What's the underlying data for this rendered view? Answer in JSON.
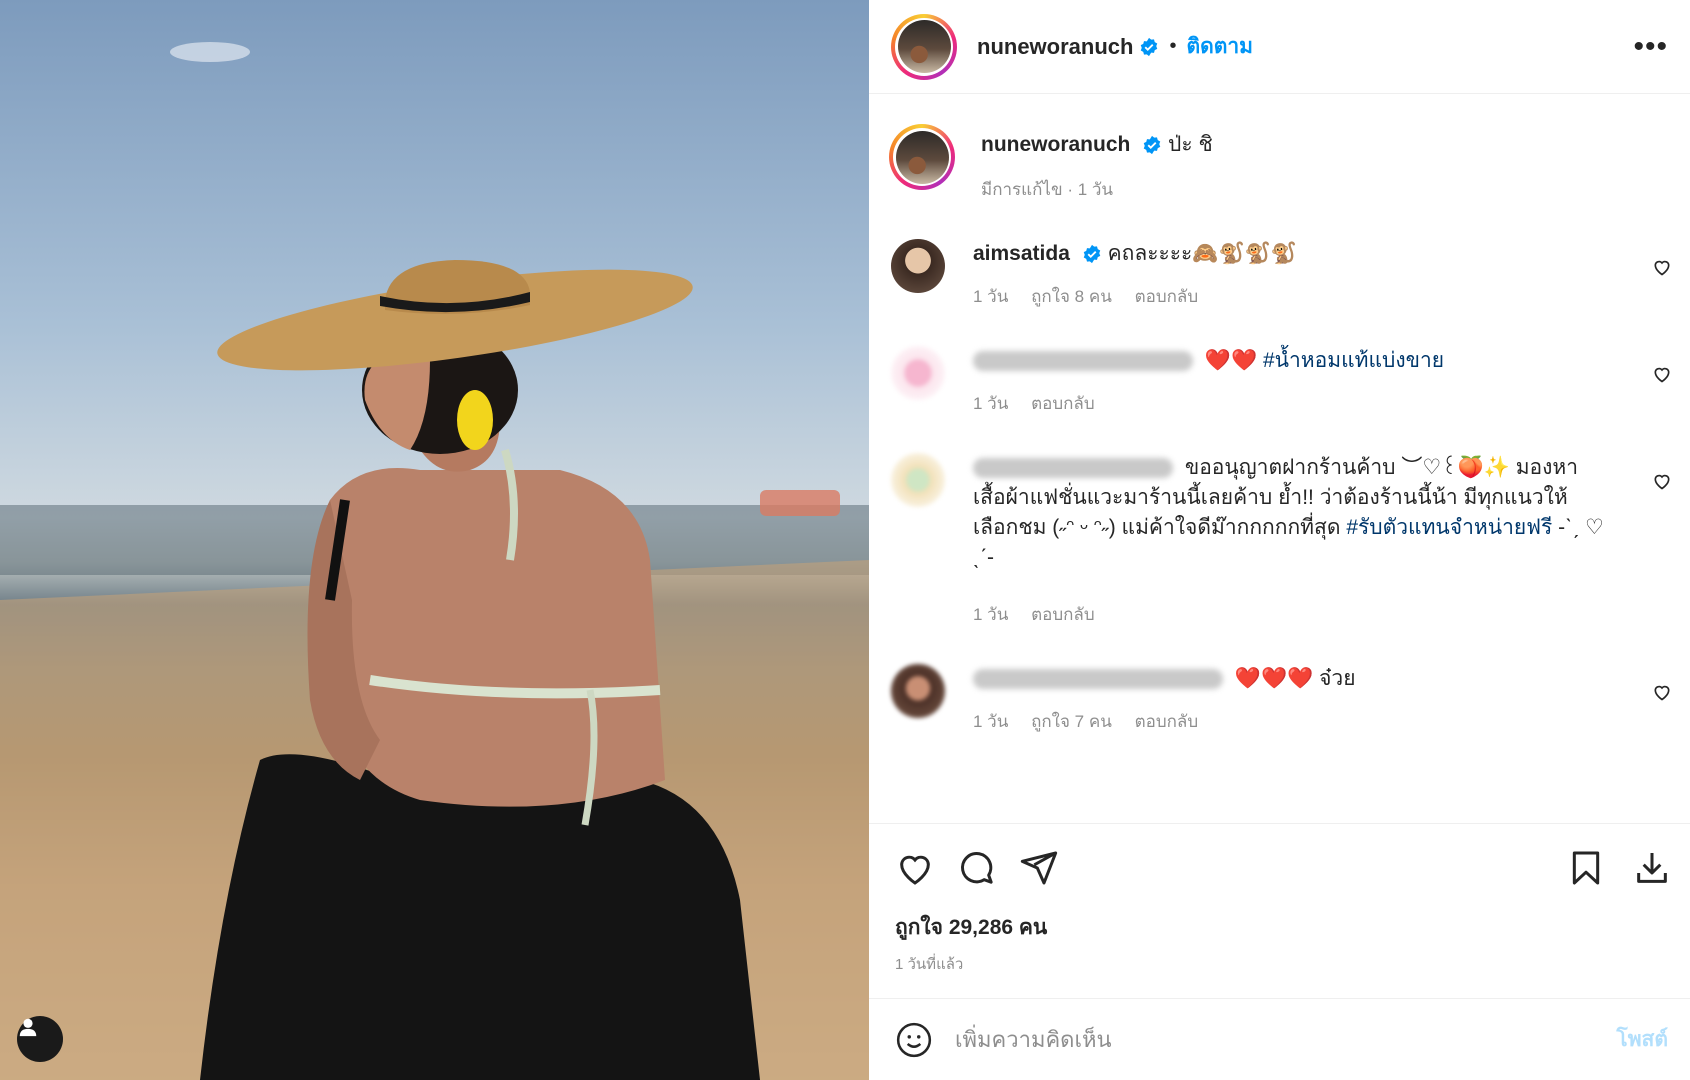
{
  "header": {
    "username": "nuneworanuch",
    "separator": "•",
    "follow_label": "ติดตาม",
    "more_label": "•••"
  },
  "caption": {
    "username": "nuneworanuch",
    "text": "ป่ะ ชิ",
    "meta": "มีการแก้ไข · 1 วัน"
  },
  "comments": [
    {
      "username": "aimsatida",
      "verified": true,
      "text": "คถละะะะ🙈🐒🐒🐒",
      "time": "1 วัน",
      "likes": "ถูกใจ 8 คน",
      "reply": "ตอบกลับ"
    },
    {
      "username": "",
      "verified": false,
      "text_prefix": "❤️❤️",
      "hashtag": "#น้ำหอมแท้แบ่งขาย",
      "time": "1 วัน",
      "likes": "",
      "reply": "ตอบกลับ"
    },
    {
      "username": "",
      "verified": false,
      "text": "ขออนุญาตฝากร้านค้าบ ︶♡꒰🍑✨ มองหาเสื้อผ้าแฟชั่นแวะมาร้านนี้เลยค้าบ ย้ำ!! ว่าต้องร้านนี้น้า มีทุกแนวให้เลือกชม (˶ᵔ ᵕ ᵔ˶) แม่ค้าใจดีม๊ากกกกกที่สุด",
      "hashtag": "#รับตัวแทนจำหน่ายฟรี",
      "suffix": "-ˋˏ ♡ ˎˊ-",
      "time": "1 วัน",
      "likes": "",
      "reply": "ตอบกลับ"
    },
    {
      "username": "",
      "verified": false,
      "text": "❤️❤️❤️ จ๋วย",
      "time": "1 วัน",
      "likes": "ถูกใจ 7 คน",
      "reply": "ตอบกลับ"
    }
  ],
  "likes_count": "ถูกใจ 29,286 คน",
  "posted_ago": "1 วันที่แล้ว",
  "add_comment": {
    "placeholder": "เพิ่มความคิดเห็น",
    "post_label": "โพสต์"
  },
  "icons": {
    "verified": "verified-badge-icon",
    "heart": "heart-icon",
    "comment": "comment-icon",
    "share": "paper-plane-icon",
    "save": "bookmark-icon",
    "download": "download-icon",
    "emoji": "emoji-icon",
    "user_tag": "user-icon"
  },
  "colors": {
    "accent": "#0095f6",
    "hashtag": "#00376b",
    "muted": "#8e8e8e"
  }
}
